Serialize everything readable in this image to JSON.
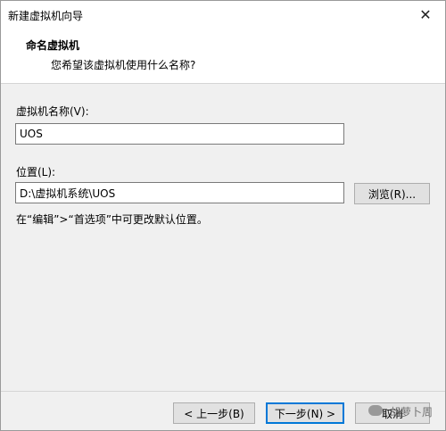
{
  "window": {
    "title": "新建虚拟机向导",
    "close_glyph": "✕"
  },
  "header": {
    "title": "命名虚拟机",
    "subtitle": "您希望该虚拟机使用什么名称?"
  },
  "form": {
    "name_label": "虚拟机名称(V):",
    "name_value": "UOS",
    "location_label": "位置(L):",
    "location_value": "D:\\虚拟机系统\\UOS",
    "browse_label": "浏览(R)...",
    "hint": "在“编辑”>“首选项”中可更改默认位置。"
  },
  "footer": {
    "back_label": "< 上一步(B)",
    "next_label": "下一步(N) >",
    "cancel_label": "取消"
  },
  "watermark": {
    "text": "胡萝卜周"
  }
}
